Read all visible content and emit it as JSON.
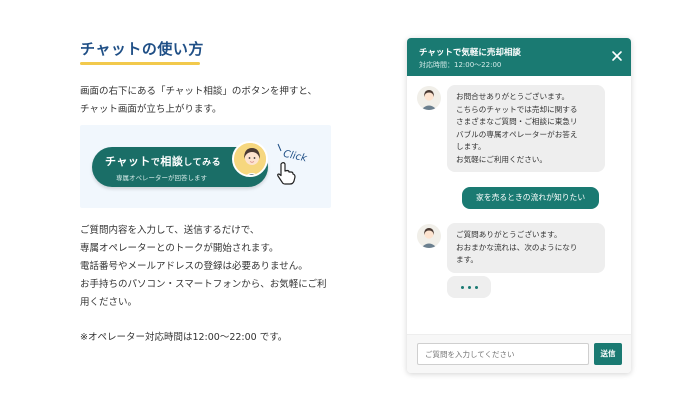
{
  "guide": {
    "heading": "チャットの使い方",
    "intro_lines": [
      "画面の右下にある「チャット相談」のボタンを押すと、",
      "チャット画面が立ち上がります。"
    ],
    "demo_button": {
      "main_a": "チャット",
      "main_b": "で",
      "main_c": "相談",
      "main_d": "してみる",
      "sub": "専属オペレーターが回答します",
      "click_label": "Click"
    },
    "body_lines": [
      "ご質問内容を入力して、送信するだけで、",
      "専属オペレーターとのトークが開始されます。",
      "電話番号やメールアドレスの登録は必要ありません。",
      "お手持ちのパソコン・スマートフォンから、お気軽にご利",
      "用ください。"
    ],
    "hours_note": "※オペレーター対応時間は12:00〜22:00 です。"
  },
  "chat": {
    "title": "チャットで気軽に売却相談",
    "hours": "対応時間：12:00〜22:00",
    "messages": [
      {
        "from": "operator",
        "lines": [
          "お問合せありがとうございます。",
          "こちらのチャットでは売却に関する",
          "さまざまなご質問・ご相談に東急リ",
          "バブルの専属オペレーターがお答え",
          "します。",
          "お気軽にご利用ください。"
        ]
      },
      {
        "from": "user",
        "text": "家を売るときの流れが知りたい"
      },
      {
        "from": "operator",
        "lines": [
          "ご質問ありがとうございます。",
          "おおまかな流れは、次のようになり",
          "ます。"
        ]
      }
    ],
    "input_placeholder": "ご質問を入力してください",
    "send_label": "送信"
  },
  "colors": {
    "brand_teal": "#1a7a72",
    "heading_blue": "#1f4f86",
    "accent_yellow": "#f2c94c"
  },
  "icons": [
    "close-icon",
    "operator-avatar-icon",
    "pointer-cursor-icon"
  ]
}
